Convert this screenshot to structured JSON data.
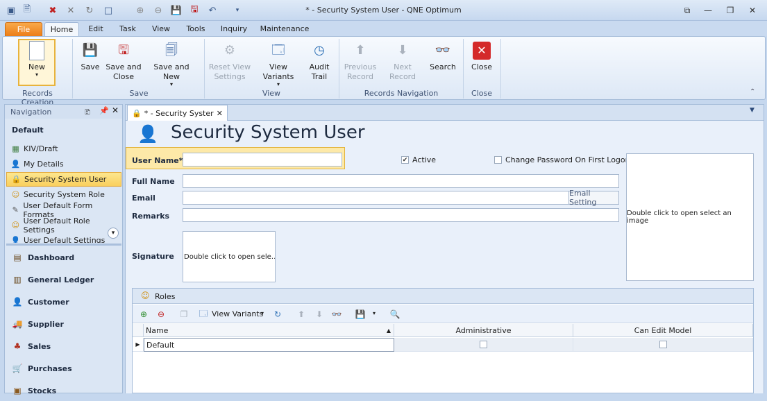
{
  "window": {
    "title": "* - Security System User - QNE Optimum"
  },
  "tabs": [
    "File",
    "Home",
    "Edit",
    "Task",
    "View",
    "Tools",
    "Inquiry",
    "Maintenance"
  ],
  "ribbon": {
    "new": "New",
    "save": "Save",
    "save_close_1": "Save and",
    "save_close_2": "Close",
    "save_new": "Save and New",
    "reset_view_1": "Reset View",
    "reset_view_2": "Settings",
    "view_variants": "View Variants",
    "audit_trail_1": "Audit",
    "audit_trail_2": "Trail",
    "prev_1": "Previous",
    "prev_2": "Record",
    "next": "Next Record",
    "search": "Search",
    "close": "Close",
    "groups": {
      "records_creation": "Records Creation",
      "save": "Save",
      "view": "View",
      "records_nav": "Records Navigation",
      "close": "Close"
    }
  },
  "navigation": {
    "title": "Navigation",
    "section": "Default",
    "items": [
      "KIV/Draft",
      "My Details",
      "Security System User",
      "Security System Role",
      "User Default Form Formats",
      "User Default Role Settings",
      "User Default Settings"
    ],
    "modules": [
      "Dashboard",
      "General Ledger",
      "Customer",
      "Supplier",
      "Sales",
      "Purchases",
      "Stocks"
    ]
  },
  "doc_tab": "* - Security Syster",
  "form": {
    "heading": "Security System User",
    "user_name_label": "User Name*",
    "user_name_value": "",
    "active_label": "Active",
    "active_checked": true,
    "change_pw_label": "Change Password On First Logon",
    "change_pw_checked": false,
    "full_name_label": "Full Name",
    "email_label": "Email",
    "email_setting": "Email Setting",
    "remarks_label": "Remarks",
    "signature_label": "Signature",
    "signature_placeholder": "Double click to open sele…",
    "image_placeholder": "Double click to open select an image"
  },
  "roles": {
    "title": "Roles",
    "view_variants": "View Variants",
    "columns": [
      "Name",
      "Administrative",
      "Can Edit Model"
    ],
    "rows": [
      {
        "name": "Default",
        "administrative": false,
        "can_edit_model": false
      }
    ]
  }
}
